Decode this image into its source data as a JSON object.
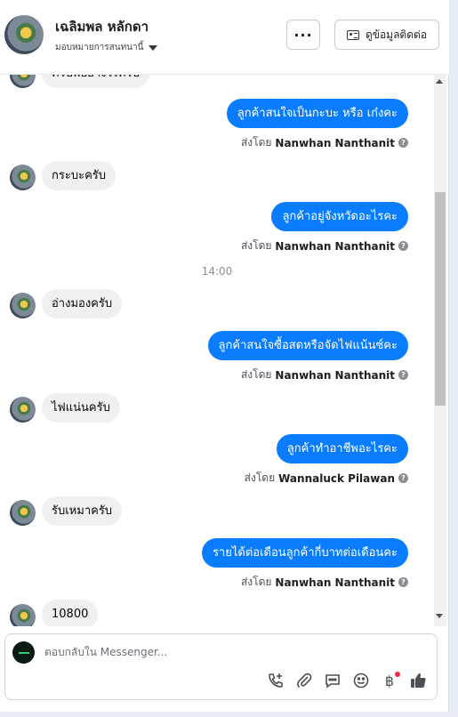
{
  "header": {
    "name": "เฉลิมพล หลักดา",
    "assign_label": "มอบหมายการสนทนานี้",
    "more_label": "···",
    "contact_label": "ดูข้อมูลติดต่อ"
  },
  "messages": [
    {
      "dir": "in",
      "text": "ครับพี่อย่างไรครับ"
    },
    {
      "dir": "out",
      "text": "ลูกค้าสนใจเป็นกะบะ หรือ เก๋งคะ",
      "sent_prefix": "ส่งโดย",
      "sender": "Nanwhan Nanthanit"
    },
    {
      "dir": "in",
      "text": "กระบะครับ"
    },
    {
      "dir": "out",
      "text": "ลูกค้าอยู่จังหวัดอะไรคะ",
      "sent_prefix": "ส่งโดย",
      "sender": "Nanwhan Nanthanit"
    },
    {
      "dir": "time",
      "text": "14:00"
    },
    {
      "dir": "in",
      "text": "อ่างมองครับ"
    },
    {
      "dir": "out",
      "text": "ลูกค้าสนใจซื้อสดหรือจัดไฟแน้นซ์คะ",
      "sent_prefix": "ส่งโดย",
      "sender": "Nanwhan Nanthanit"
    },
    {
      "dir": "in",
      "text": "ไฟแน่นครับ"
    },
    {
      "dir": "out",
      "text": "ลูกค้าทำอาชีพอะไรคะ",
      "sent_prefix": "ส่งโดย",
      "sender": "Wannaluck Pilawan"
    },
    {
      "dir": "in",
      "text": "รับเหมาครับ"
    },
    {
      "dir": "out",
      "text": "รายได้ต่อเดือนลูกค้ากี่บาทต่อเดือนคะ",
      "sent_prefix": "ส่งโดย",
      "sender": "Nanwhan Nanthanit"
    },
    {
      "dir": "in",
      "text": "10800"
    }
  ],
  "composer": {
    "placeholder": "ตอบกลับใน Messenger...",
    "tools": [
      "call-add-icon",
      "attachment-icon",
      "saved-reply-icon",
      "emoji-icon",
      "baht-icon",
      "like-icon"
    ],
    "baht_symbol": "฿"
  },
  "colors": {
    "outgoing_bubble": "#0a7cff",
    "incoming_bubble": "#f0f0f0",
    "notification_dot": "#f02849"
  }
}
